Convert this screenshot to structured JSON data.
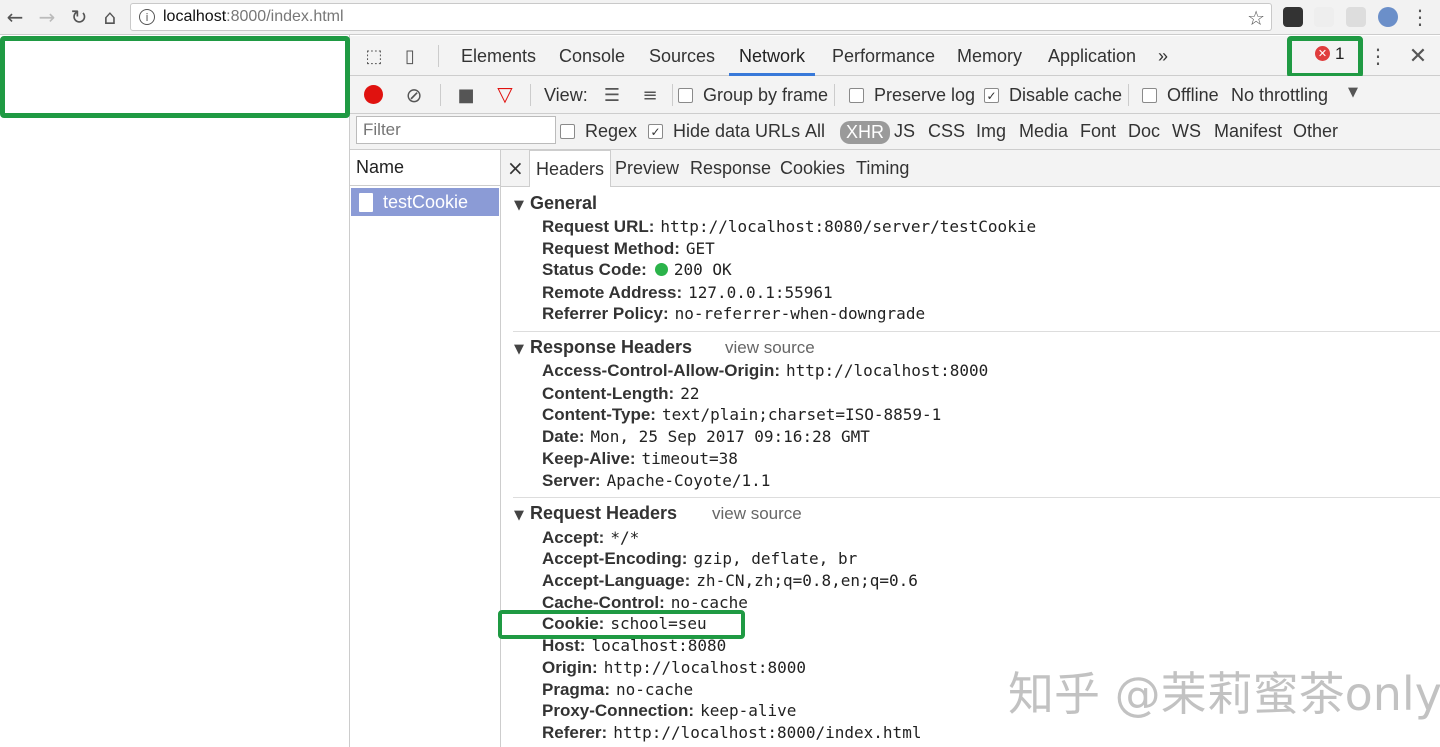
{
  "browser": {
    "url_host": "localhost",
    "url_rest": ":8000/index.html",
    "info_glyph": "i"
  },
  "devtools": {
    "tabs": [
      "Elements",
      "Console",
      "Sources",
      "Network",
      "Performance",
      "Memory",
      "Application"
    ],
    "active_tab": "Network",
    "more_glyph": "»",
    "error_count": "1",
    "toolbar": {
      "view_label": "View:",
      "group_by_frame": "Group by frame",
      "preserve_log": "Preserve log",
      "disable_cache": "Disable cache",
      "offline": "Offline",
      "throttling": "No throttling"
    },
    "filter": {
      "placeholder": "Filter",
      "regex": "Regex",
      "hide_data_urls": "Hide data URLs",
      "types": [
        "All",
        "XHR",
        "JS",
        "CSS",
        "Img",
        "Media",
        "Font",
        "Doc",
        "WS",
        "Manifest",
        "Other"
      ],
      "active_type": "XHR"
    },
    "name_header": "Name",
    "request_name": "testCookie",
    "detail_tabs": [
      "Headers",
      "Preview",
      "Response",
      "Cookies",
      "Timing"
    ],
    "close_glyph": "×",
    "general": {
      "title": "General",
      "rows": [
        {
          "k": "Request URL:",
          "v": "http://localhost:8080/server/testCookie"
        },
        {
          "k": "Request Method:",
          "v": "GET"
        },
        {
          "k": "Status Code:",
          "v": "200 OK"
        },
        {
          "k": "Remote Address:",
          "v": "127.0.0.1:55961"
        },
        {
          "k": "Referrer Policy:",
          "v": "no-referrer-when-downgrade"
        }
      ]
    },
    "response_headers": {
      "title": "Response Headers",
      "view_source": "view source",
      "rows": [
        {
          "k": "Access-Control-Allow-Origin:",
          "v": "http://localhost:8000"
        },
        {
          "k": "Content-Length:",
          "v": "22"
        },
        {
          "k": "Content-Type:",
          "v": "text/plain;charset=ISO-8859-1"
        },
        {
          "k": "Date:",
          "v": "Mon, 25 Sep 2017 09:16:28 GMT"
        },
        {
          "k": "Keep-Alive:",
          "v": "timeout=38"
        },
        {
          "k": "Server:",
          "v": "Apache-Coyote/1.1"
        }
      ]
    },
    "request_headers": {
      "title": "Request Headers",
      "view_source": "view source",
      "rows": [
        {
          "k": "Accept:",
          "v": "*/*"
        },
        {
          "k": "Accept-Encoding:",
          "v": "gzip, deflate, br"
        },
        {
          "k": "Accept-Language:",
          "v": "zh-CN,zh;q=0.8,en;q=0.6"
        },
        {
          "k": "Cache-Control:",
          "v": "no-cache"
        },
        {
          "k": "Cookie:",
          "v": "school=seu"
        },
        {
          "k": "Host:",
          "v": "localhost:8080"
        },
        {
          "k": "Origin:",
          "v": "http://localhost:8000"
        },
        {
          "k": "Pragma:",
          "v": "no-cache"
        },
        {
          "k": "Proxy-Connection:",
          "v": "keep-alive"
        },
        {
          "k": "Referer:",
          "v": "http://localhost:8000/index.html"
        }
      ]
    }
  },
  "watermark": "知乎 @茉莉蜜茶only",
  "colors": {
    "highlight_green": "#1f9a43",
    "selected_row": "#8b9bd6",
    "active_tab_underline": "#3879d9",
    "status_dot": "#2bb34a"
  }
}
